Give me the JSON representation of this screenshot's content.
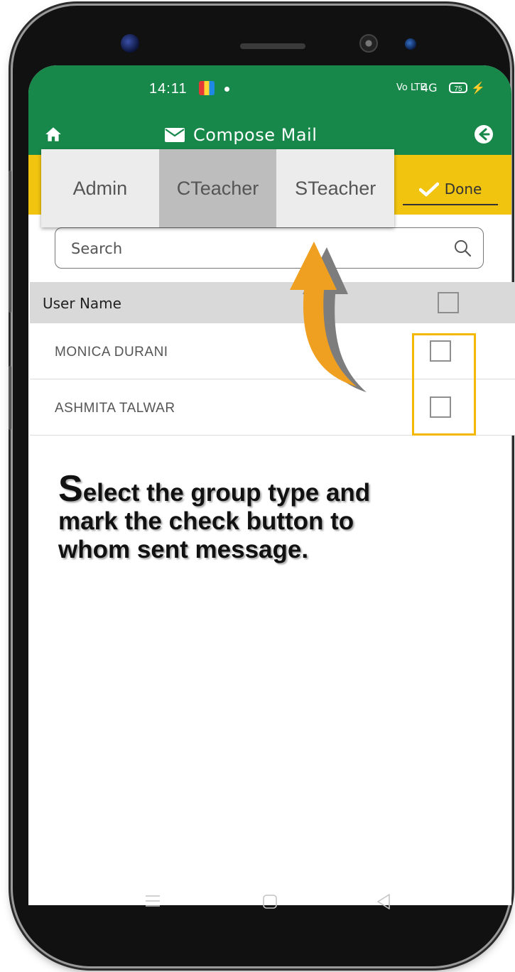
{
  "status_bar": {
    "time": "14:11",
    "signal_label": "Vo LTE",
    "network_label": "4G",
    "battery": "75"
  },
  "app_bar": {
    "title": "Compose Mail",
    "home_icon": "home-icon",
    "mail_icon": "mail-icon",
    "back_icon": "back-arrow-icon"
  },
  "tabs": [
    {
      "label": "Admin",
      "active": false
    },
    {
      "label": "CTeacher",
      "active": true
    },
    {
      "label": "STeacher",
      "active": false
    }
  ],
  "done_button": {
    "label": "Done",
    "icon": "check-icon"
  },
  "search": {
    "placeholder": "Search",
    "value": ""
  },
  "table": {
    "header": "User Name",
    "rows": [
      {
        "name": "MONICA DURANI",
        "checked": false
      },
      {
        "name": "ASHMITA TALWAR",
        "checked": false
      }
    ]
  },
  "instruction": {
    "first_letter": "S",
    "text_rest": "elect the group type and mark the check button to whom sent message."
  },
  "colors": {
    "app_bar": "#17884a",
    "done_bar": "#f1c40f",
    "highlight_border": "#f5b800",
    "arrow": "#f0a020"
  }
}
